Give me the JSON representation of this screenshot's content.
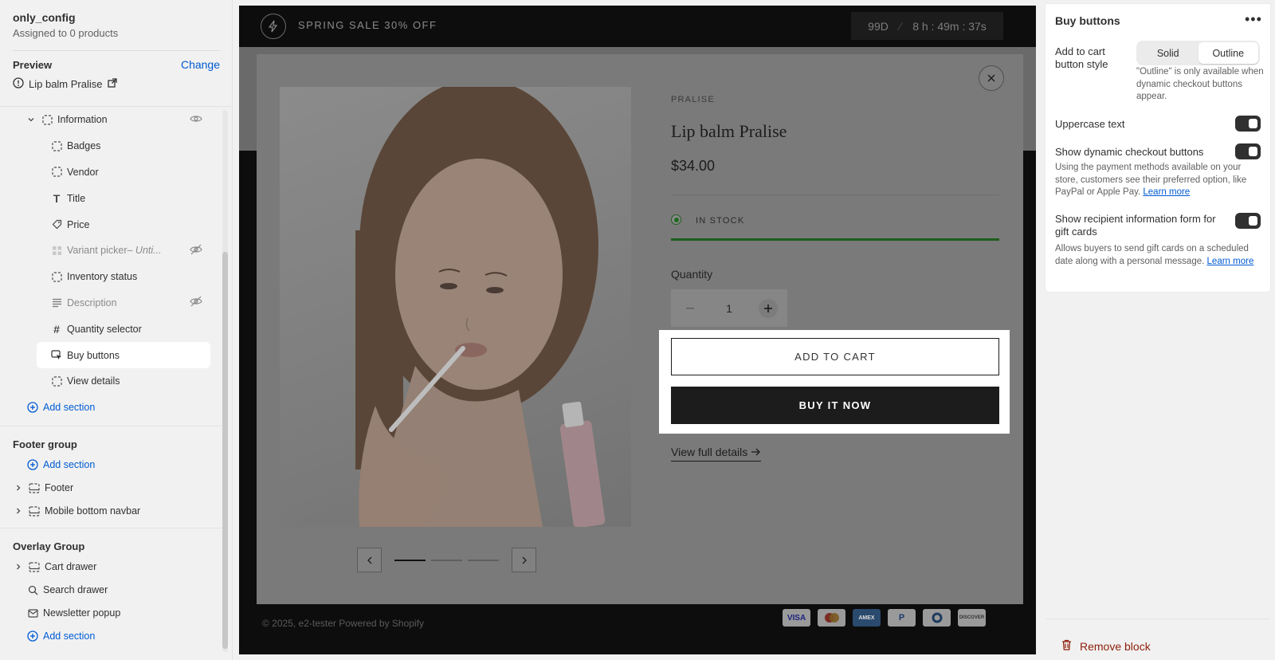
{
  "sidebar": {
    "config_name": "only_config",
    "assigned": "Assigned to 0 products",
    "preview_label": "Preview",
    "change_label": "Change",
    "preview_product": "Lip balm Pralise",
    "tree": {
      "information": "Information",
      "badges": "Badges",
      "vendor": "Vendor",
      "title": "Title",
      "price": "Price",
      "variant_picker": "Variant picker",
      "variant_suffix": " – Unti...",
      "inventory": "Inventory status",
      "description": "Description",
      "quantity": "Quantity selector",
      "buy_buttons": "Buy buttons",
      "view_details": "View details",
      "add_section": "Add section"
    },
    "footer_group": {
      "title": "Footer group",
      "add_section": "Add section",
      "footer": "Footer",
      "mobile_navbar": "Mobile bottom navbar"
    },
    "overlay_group": {
      "title": "Overlay Group",
      "cart_drawer": "Cart drawer",
      "search_drawer": "Search drawer",
      "newsletter": "Newsletter popup",
      "add_section": "Add section"
    }
  },
  "preview": {
    "announcement": "SPRING SALE 30% OFF",
    "countdown": {
      "days": "99D",
      "slash": "⁄",
      "hms": "8 h : 49m : 37s"
    },
    "modal": {
      "vendor": "PRALISE",
      "title": "Lip balm Pralise",
      "price": "$34.00",
      "stock": "IN STOCK",
      "quantity_label": "Quantity",
      "quantity_value": "1",
      "add_to_cart": "ADD TO CART",
      "buy_now": "BUY IT NOW",
      "view_details": "View full details",
      "close": "✕"
    },
    "footer": {
      "copyright": "© 2025, e2-tester Powered by Shopify",
      "payments": [
        "VISA",
        "MC",
        "AMEX",
        "PayPal",
        "Diners",
        "DISCOVER"
      ]
    }
  },
  "panel": {
    "title": "Buy buttons",
    "style_label": "Add to cart button style",
    "style_options": [
      "Solid",
      "Outline"
    ],
    "style_selected": "Outline",
    "style_help": "\"Outline\" is only available when dynamic checkout buttons appear.",
    "uppercase_label": "Uppercase text",
    "dynamic_label": "Show dynamic checkout buttons",
    "dynamic_help": "Using the payment methods available on your store, customers see their preferred option, like PayPal or Apple Pay.",
    "recipient_label": "Show recipient information form for gift cards",
    "recipient_help": "Allows buyers to send gift cards on a scheduled date along with a personal message.",
    "learn_more": "Learn more",
    "remove_block": "Remove block"
  },
  "colors": {
    "accent": "#005bd3",
    "danger": "#8e1f0b",
    "stock_green": "#1e6a1e"
  }
}
